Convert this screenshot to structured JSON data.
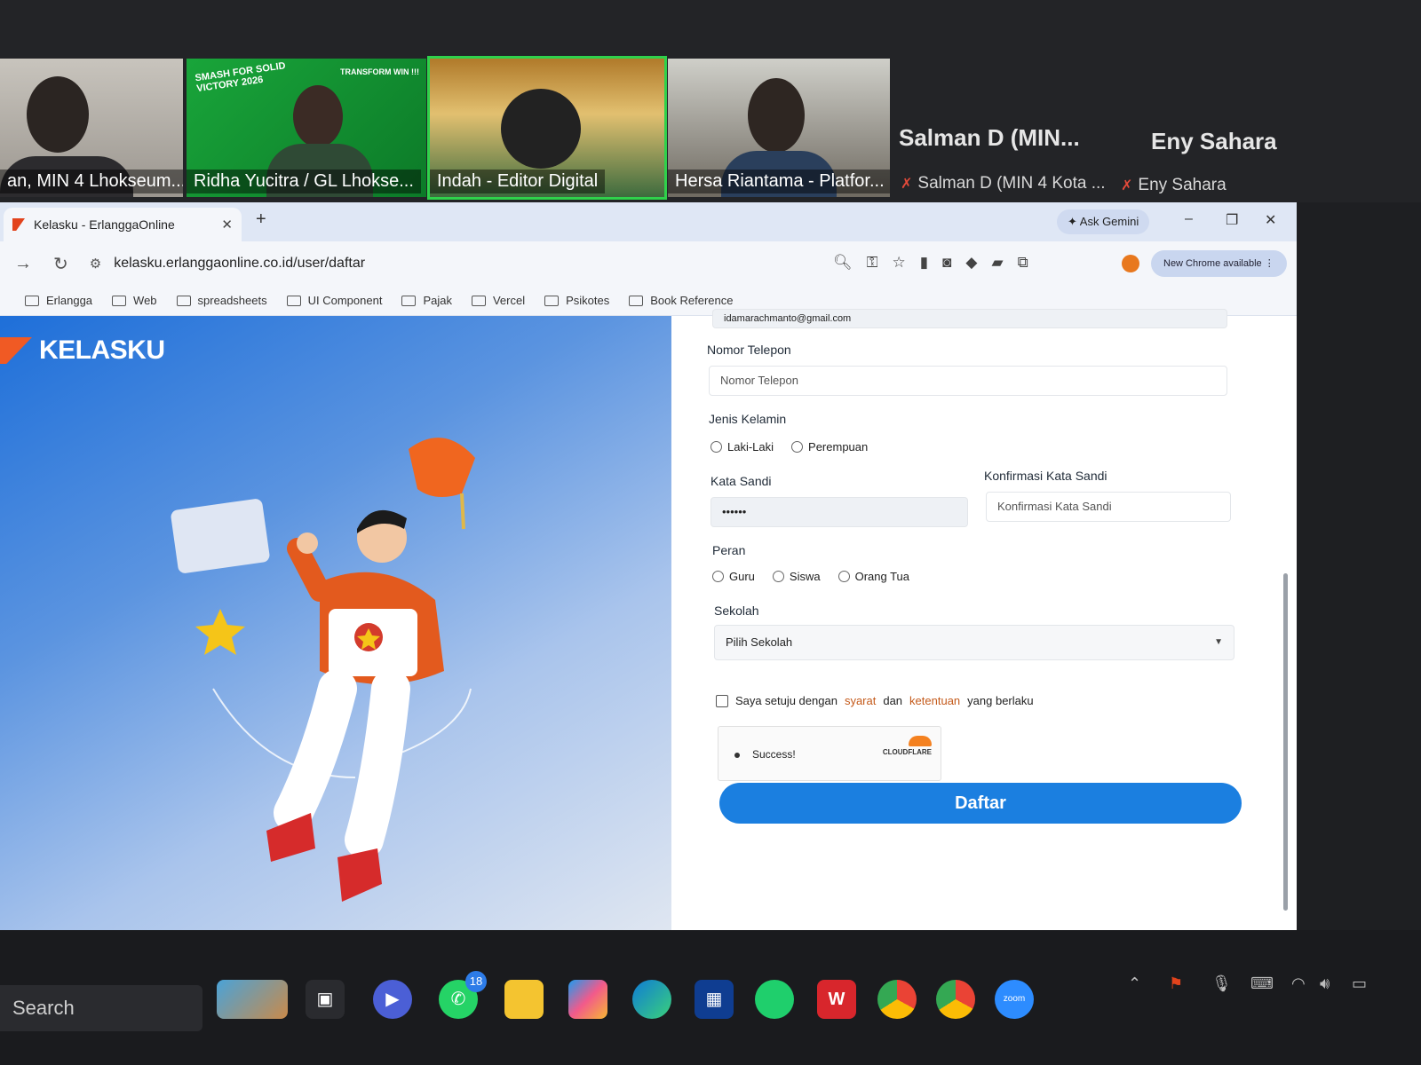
{
  "zoom": {
    "participants": [
      {
        "name": "an, MIN 4 Lhokseum..."
      },
      {
        "name": "Ridha Yucitra / GL Lhokse...",
        "banner": "SMASH FOR SOLID VICTORY 2026",
        "banner2": "TRANSFORM WIN !!!"
      },
      {
        "name": "Indah - Editor Digital"
      },
      {
        "name": "Hersa Riantama - Platfor..."
      }
    ],
    "audio_only": [
      {
        "name": "Salman D (MIN...",
        "sub": "Salman D (MIN 4 Kota ..."
      },
      {
        "name": "Eny Sahara",
        "sub": "Eny Sahara"
      }
    ]
  },
  "browser": {
    "tab_title": "Kelasku - ErlanggaOnline",
    "tab_close": "✕",
    "new_tab": "+",
    "ask_gemini": "✦ Ask Gemini",
    "window_controls": [
      "–",
      "❐",
      "✕"
    ],
    "url": "kelasku.erlanggaonline.co.id/user/daftar",
    "chrome_update": "New Chrome available  ⋮",
    "bookmarks": [
      "Erlangga",
      "Web",
      "spreadsheets",
      "UI Component",
      "Pajak",
      "Vercel",
      "Psikotes",
      "Book Reference"
    ]
  },
  "page": {
    "brand": "KELASKU",
    "form": {
      "email_value": "idamarachmanto@gmail.com",
      "phone_label": "Nomor Telepon",
      "phone_placeholder": "Nomor Telepon",
      "gender_label": "Jenis Kelamin",
      "gender_options": [
        "Laki-Laki",
        "Perempuan"
      ],
      "password_label": "Kata Sandi",
      "password_value": "••••••",
      "confirm_label": "Konfirmasi Kata Sandi",
      "confirm_placeholder": "Konfirmasi Kata Sandi",
      "role_label": "Peran",
      "role_options": [
        "Guru",
        "Siswa",
        "Orang Tua"
      ],
      "school_label": "Sekolah",
      "school_placeholder": "Pilih Sekolah",
      "terms_prefix": "Saya setuju dengan",
      "terms_link1": "syarat",
      "terms_mid": "dan",
      "terms_link2": "ketentuan",
      "terms_suffix": "yang berlaku",
      "captcha_status": "Success!",
      "captcha_brand": "CLOUDFLARE",
      "submit_label": "Daftar"
    }
  },
  "taskbar": {
    "search": "Search",
    "whatsapp_badge": "18",
    "apps": [
      "widgets",
      "task-view",
      "meet",
      "whatsapp",
      "file-explorer",
      "copilot",
      "edge",
      "store",
      "app-green",
      "wps",
      "chrome",
      "chrome-profile",
      "zoom"
    ],
    "zoom_label": "zoom"
  },
  "colors": {
    "accent": "#1b7fe0",
    "brand_orange": "#f05a24",
    "zoom_active_border": "#2fd14b"
  }
}
